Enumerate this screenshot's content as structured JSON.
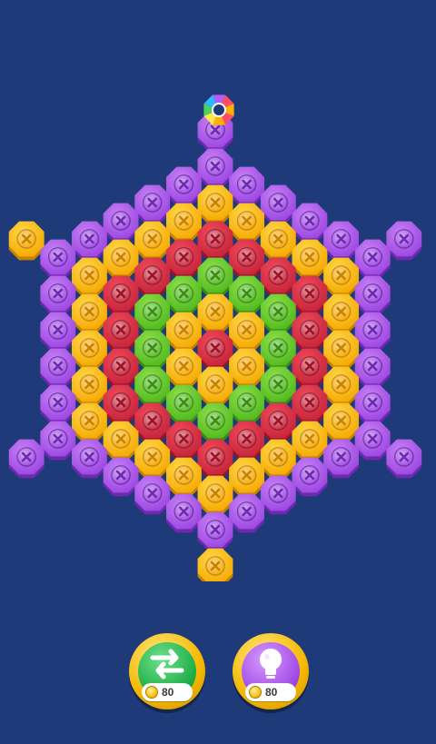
{
  "board": {
    "rings": {
      "0": "red",
      "1": "yellow",
      "2": "green",
      "3": "red",
      "4": "yellow",
      "5": "purple"
    },
    "extra_pieces": [
      "purple",
      "purple",
      "yellow",
      "purple",
      "yellow",
      "purple"
    ],
    "colors": {
      "red": [
        "#f04a5a",
        "#c4233a",
        "#9a1428"
      ],
      "yellow": [
        "#ffd84a",
        "#f5a800",
        "#c98200"
      ],
      "green": [
        "#8fe04a",
        "#4fb81e",
        "#3a8c12"
      ],
      "purple": [
        "#c780f5",
        "#9a45e0",
        "#6f28b0"
      ]
    },
    "background": "#1f3a78"
  },
  "pin": {
    "colors": [
      "#ff4d6a",
      "#ffb000",
      "#ffe84d",
      "#4fd05a",
      "#2fb8ff",
      "#b35cff"
    ]
  },
  "powerups": {
    "swap": {
      "icon": "swap-arrows-icon",
      "cost": "80"
    },
    "hint": {
      "icon": "lightbulb-icon",
      "cost": "80"
    }
  }
}
